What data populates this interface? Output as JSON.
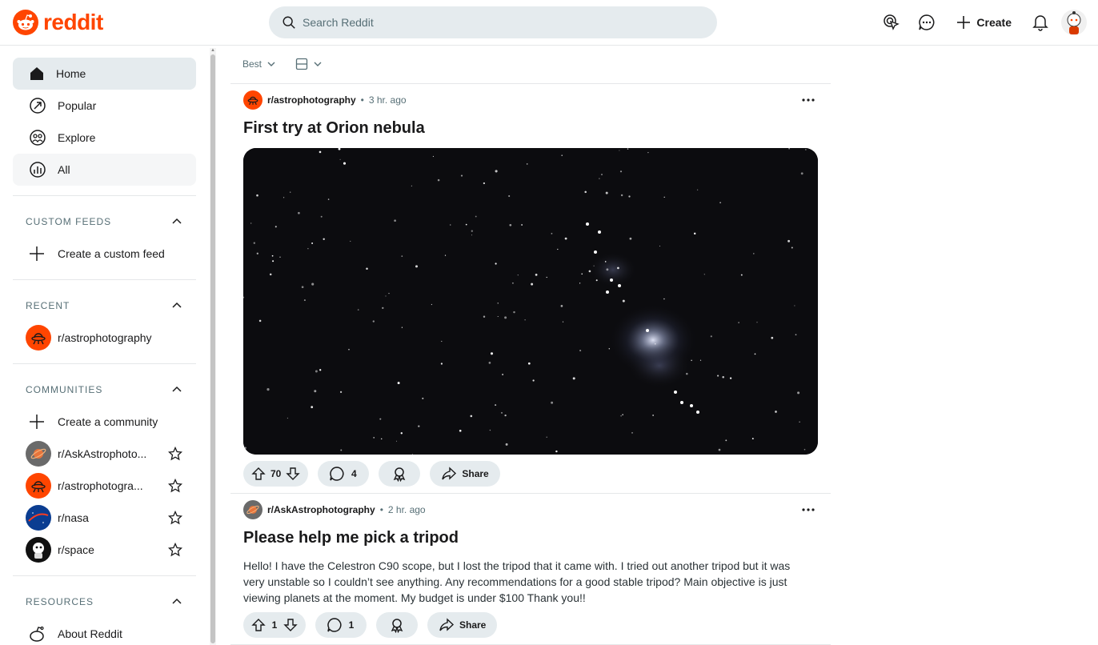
{
  "header": {
    "logo_text": "reddit",
    "search_placeholder": "Search Reddit",
    "create_label": "Create",
    "icons": [
      "advertise-icon",
      "chat-icon",
      "plus-icon",
      "bell-icon",
      "avatar"
    ]
  },
  "sidebar": {
    "nav": [
      {
        "label": "Home",
        "icon": "home-icon"
      },
      {
        "label": "Popular",
        "icon": "popular-icon"
      },
      {
        "label": "Explore",
        "icon": "explore-icon"
      },
      {
        "label": "All",
        "icon": "all-icon"
      }
    ],
    "custom_feeds": {
      "title": "CUSTOM FEEDS",
      "create_label": "Create a custom feed"
    },
    "recent": {
      "title": "RECENT",
      "items": [
        {
          "label": "r/astrophotography"
        }
      ]
    },
    "communities": {
      "title": "COMMUNITIES",
      "create_label": "Create a community",
      "items": [
        {
          "label": "r/AskAstrophoto..."
        },
        {
          "label": "r/astrophotogra..."
        },
        {
          "label": "r/nasa"
        },
        {
          "label": "r/space"
        }
      ]
    },
    "resources": {
      "title": "RESOURCES",
      "items": [
        {
          "label": "About Reddit"
        }
      ]
    }
  },
  "feed": {
    "sort_label": "Best",
    "posts": [
      {
        "subreddit": "r/astrophotography",
        "time": "3 hr. ago",
        "title": "First try at Orion nebula",
        "votes": "70",
        "comments": "4",
        "share_label": "Share"
      },
      {
        "subreddit": "r/AskAstrophotography",
        "time": "2 hr. ago",
        "title": "Please help me pick a tripod",
        "body": "Hello! I have the Celestron C90 scope, but I lost the tripod that it came with. I tried out another tripod but it was very unstable so I couldn’t see anything. Any recommendations for a good stable tripod? Main objective is just viewing planets at the moment. My budget is under $100 Thank you!!",
        "votes": "1",
        "comments": "1",
        "share_label": "Share"
      }
    ]
  },
  "colors": {
    "brand": "#ff4500",
    "pill_bg": "#e5ebee",
    "muted": "#576f76"
  }
}
